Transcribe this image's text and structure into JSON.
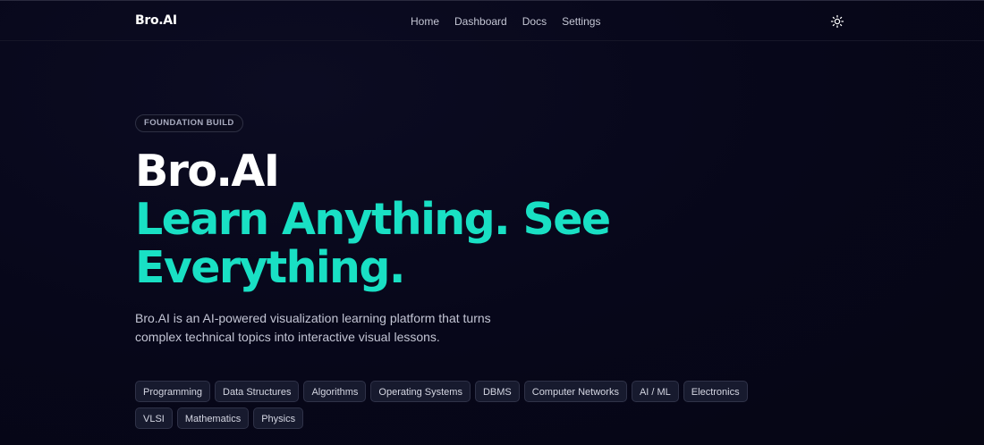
{
  "header": {
    "brand": "Bro.AI",
    "nav": [
      "Home",
      "Dashboard",
      "Docs",
      "Settings"
    ],
    "theme_icon": "sun-icon"
  },
  "hero": {
    "badge": "FOUNDATION BUILD",
    "title_line1": "Bro.AI",
    "title_line2": "Learn Anything. See Everything.",
    "description": "Bro.AI is an AI-powered visualization learning platform that turns complex technical topics into interactive visual lessons."
  },
  "topics": [
    "Programming",
    "Data Structures",
    "Algorithms",
    "Operating Systems",
    "DBMS",
    "Computer Networks",
    "AI / ML",
    "Electronics",
    "VLSI",
    "Mathematics",
    "Physics"
  ],
  "colors": {
    "background": "#070716",
    "accent": "#19e0c4",
    "chip_background": "#171a2e",
    "text": "#ffffff"
  }
}
